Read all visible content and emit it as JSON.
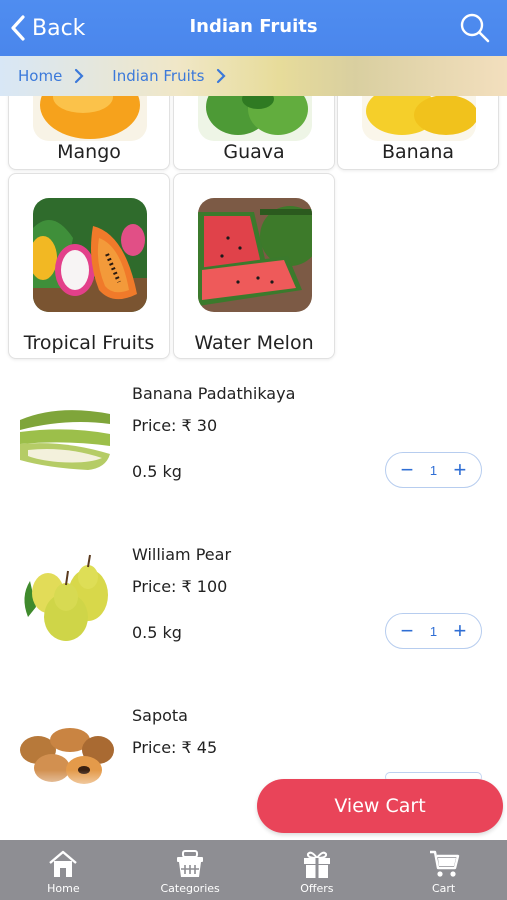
{
  "header": {
    "back_label": "Back",
    "title": "Indian Fruits",
    "search_icon": "search-icon"
  },
  "breadcrumb": {
    "items": [
      "Home",
      "Indian Fruits"
    ]
  },
  "categories": [
    {
      "label": "Mango",
      "icon": "mango-image"
    },
    {
      "label": "Guava",
      "icon": "guava-image"
    },
    {
      "label": "Banana",
      "icon": "banana-image"
    },
    {
      "label": "Tropical Fruits",
      "icon": "tropical-fruits-image"
    },
    {
      "label": "Water Melon",
      "icon": "watermelon-image"
    }
  ],
  "products": [
    {
      "name": "Banana Padathikaya",
      "price": "Price: ₹ 30",
      "weight": "0.5 kg",
      "qty": "1",
      "minus": "−",
      "plus": "+"
    },
    {
      "name": "William Pear",
      "price": "Price: ₹ 100",
      "weight": "0.5 kg",
      "qty": "1",
      "minus": "−",
      "plus": "+"
    },
    {
      "name": "Sapota",
      "price": "Price: ₹ 45"
    }
  ],
  "cart": {
    "view_cart_label": "View Cart"
  },
  "tabbar": {
    "items": [
      {
        "label": "Home",
        "icon": "home-icon"
      },
      {
        "label": "Categories",
        "icon": "basket-icon"
      },
      {
        "label": "Offers",
        "icon": "gift-icon"
      },
      {
        "label": "Cart",
        "icon": "cart-icon"
      }
    ]
  },
  "colors": {
    "header": "#4a86ec",
    "accent": "#2f6ed4",
    "view_cart": "#e94459",
    "tabbar": "#8e8e93"
  }
}
